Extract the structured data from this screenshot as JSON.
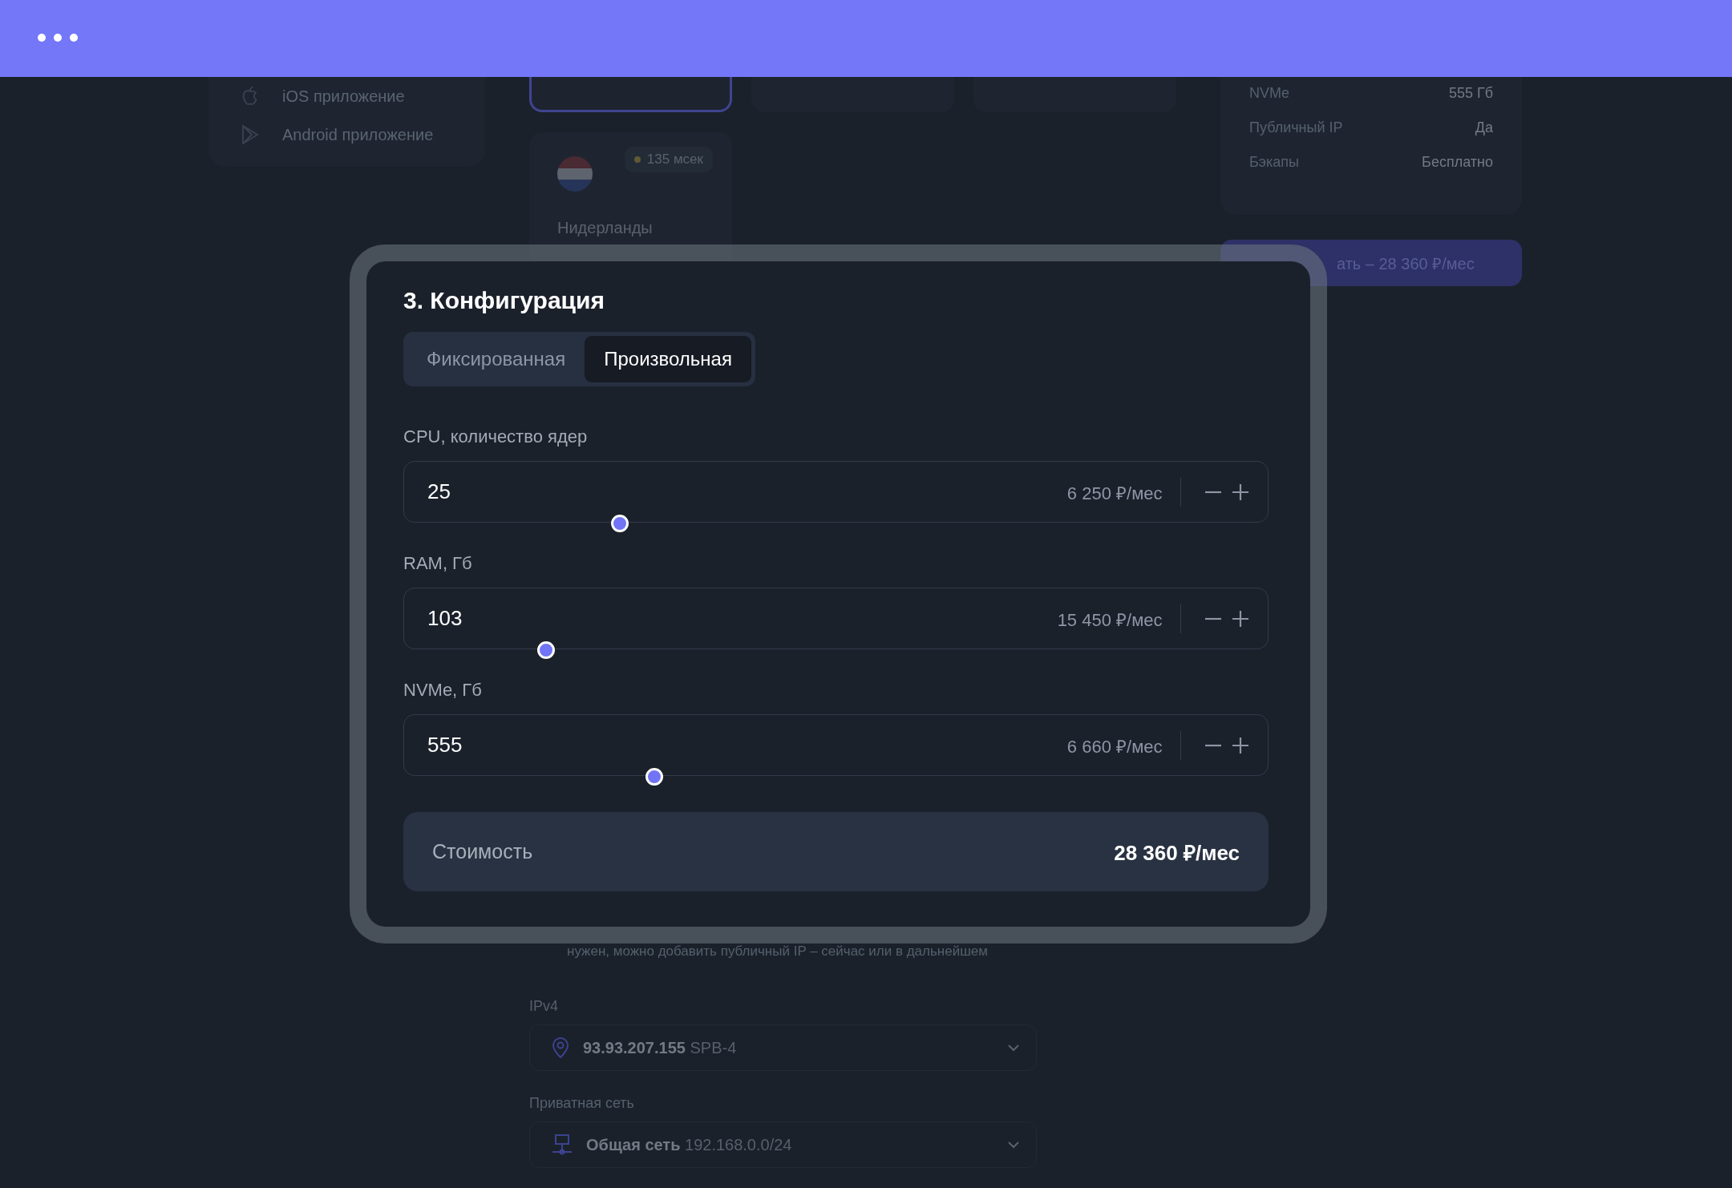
{
  "sidebar": {
    "items": [
      {
        "kind": "apple",
        "label": "iOS приложение"
      },
      {
        "kind": "play",
        "label": "Android приложение"
      }
    ]
  },
  "locations": [
    {
      "selected": true
    },
    {
      "selected": false
    },
    {
      "selected": false
    }
  ],
  "location_card": {
    "latency": "135 мсек",
    "name": "Нидерланды"
  },
  "summary": {
    "rows": [
      {
        "label": "NVMe",
        "value": "555 Гб"
      },
      {
        "label": "Публичный IP",
        "value": "Да"
      },
      {
        "label": "Бэкапы",
        "value": "Бесплатно"
      }
    ]
  },
  "order_button": {
    "label": "ать – 28 360 ₽/мес"
  },
  "network": {
    "hint": "нужен, можно добавить публичный IP – сейчас или в дальнейшем",
    "selects": [
      {
        "kind": "pin",
        "label": "IPv4",
        "value": "93.93.207.155",
        "suffix": "SPB-4"
      },
      {
        "kind": "network",
        "label": "Приватная сеть",
        "value": "Общая сеть",
        "suffix": "192.168.0.0/24"
      }
    ]
  },
  "config": {
    "title": "3. Конфигурация",
    "modes": [
      {
        "label": "Фиксированная",
        "selected": false
      },
      {
        "label": "Произвольная",
        "selected": true
      }
    ],
    "params": [
      {
        "label": "CPU, количество ядер",
        "value": "25",
        "price": "6 250 ₽/мес",
        "level": 0.25
      },
      {
        "label": "RAM, Гб",
        "value": "103",
        "price": "15 450 ₽/мес",
        "level": 0.165
      },
      {
        "label": "NVMe, Гб",
        "value": "555",
        "price": "6 660 ₽/мес",
        "level": 0.29
      }
    ],
    "total": {
      "label": "Стоимость",
      "value": "28 360 ₽/мес"
    }
  }
}
